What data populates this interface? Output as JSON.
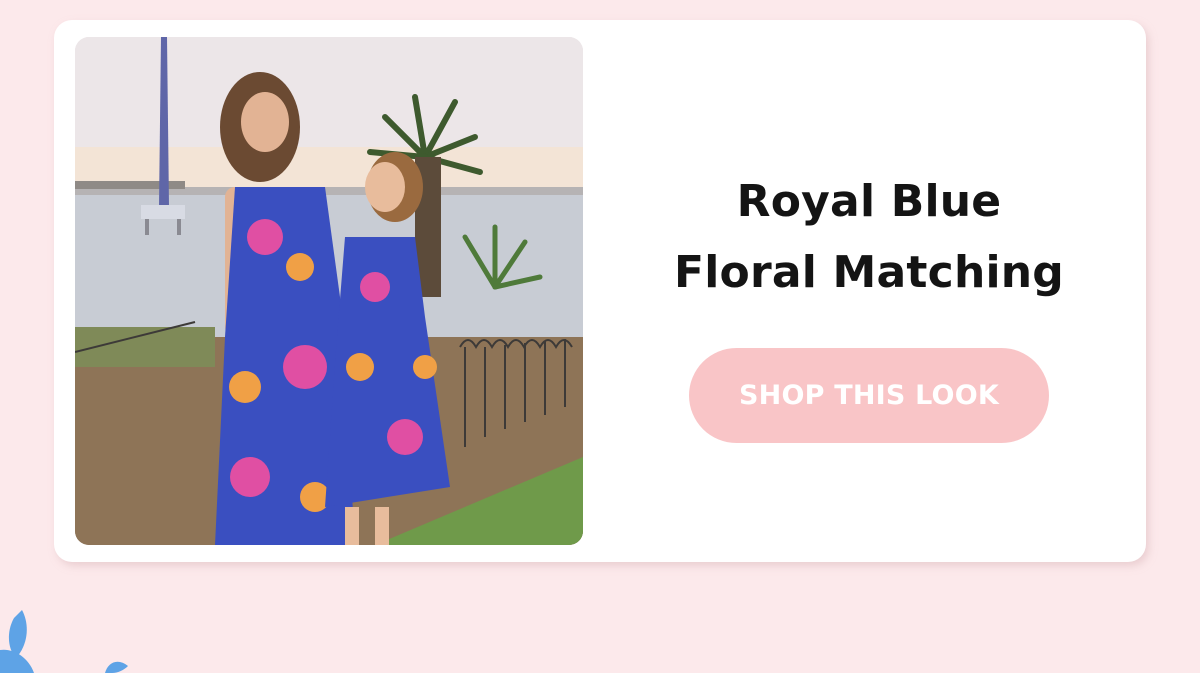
{
  "product": {
    "title_line1": "Royal Blue",
    "title_line2": "Floral Matching",
    "image_alt": "Mother and daughter wearing matching royal blue floral halter dresses by the water at sunset"
  },
  "cta": {
    "label": "SHOP THIS LOOK"
  },
  "colors": {
    "page_background": "#fce9eb",
    "card_background": "#ffffff",
    "button_background": "#f9c5c7",
    "button_text": "#ffffff",
    "title_text": "#141414",
    "decoration_blue": "#5ea3e6"
  },
  "icons": {
    "decoration": "blue-leaf-icon"
  }
}
